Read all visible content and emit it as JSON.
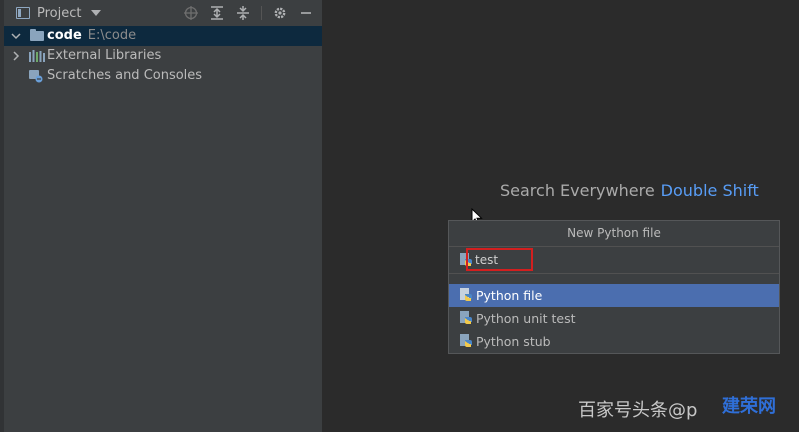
{
  "project_panel": {
    "title": "Project",
    "tree": [
      {
        "label": "code",
        "path": "E:\\code",
        "expanded": true,
        "icon": "folder-icon"
      },
      {
        "label": "External Libraries",
        "expanded": false,
        "icon": "library-icon"
      },
      {
        "label": "Scratches and Consoles",
        "icon": "scratches-icon"
      }
    ]
  },
  "editor": {
    "hint_text": "Search Everywhere",
    "hint_shortcut": "Double Shift"
  },
  "new_file_popup": {
    "title": "New Python file",
    "name_value": "test",
    "options": [
      {
        "label": "Python file",
        "selected": true
      },
      {
        "label": "Python unit test",
        "selected": false
      },
      {
        "label": "Python stub",
        "selected": false
      }
    ]
  },
  "watermark": {
    "text": "百家号头条@p",
    "logo_text": "建荣网"
  },
  "colors": {
    "selection": "#4b6eaf",
    "highlight_box": "#d21f1f",
    "link_blue": "#589df6"
  }
}
